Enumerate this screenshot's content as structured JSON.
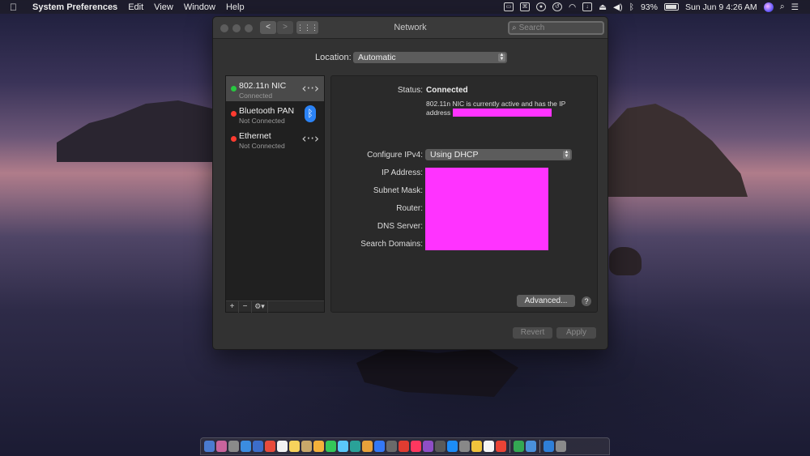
{
  "menubar": {
    "app_name": "System Preferences",
    "items": [
      "Edit",
      "View",
      "Window",
      "Help"
    ],
    "status": {
      "icons": [
        "screen-mirroring-icon",
        "command-icon",
        "lock-icon",
        "time-machine-icon",
        "wifi-icon",
        "input-icon",
        "eject-icon",
        "volume-icon",
        "bluetooth-icon"
      ],
      "battery_percent": "93%",
      "datetime": "Sun Jun 9  4:26 AM"
    }
  },
  "window": {
    "title": "Network",
    "search_placeholder": "Search",
    "location_label": "Location:",
    "location_value": "Automatic",
    "services": [
      {
        "name": "802.11n NIC",
        "status": "Connected",
        "dot_color": "#28c840",
        "icon": "ethernet-arrows-icon"
      },
      {
        "name": "Bluetooth PAN",
        "status": "Not Connected",
        "dot_color": "#ff3b30",
        "icon": "bluetooth-icon"
      },
      {
        "name": "Ethernet",
        "status": "Not Connected",
        "dot_color": "#ff3b30",
        "icon": "ethernet-arrows-icon"
      }
    ],
    "detail": {
      "status_label": "Status:",
      "status_value": "Connected",
      "status_description": "802.11n NIC  is currently active and has the IP address",
      "configure_label": "Configure IPv4:",
      "configure_value": "Using DHCP",
      "ip_label": "IP Address:",
      "subnet_label": "Subnet Mask:",
      "router_label": "Router:",
      "dns_label": "DNS Server:",
      "search_domains_label": "Search Domains:",
      "advanced_label": "Advanced...",
      "help_label": "?"
    },
    "revert_label": "Revert",
    "apply_label": "Apply",
    "tools": {
      "add": "+",
      "remove": "−",
      "gear": "⚙▾"
    }
  },
  "dock": {
    "icon_colors": [
      "#4a7bd0",
      "#c9649c",
      "#8a8a8a",
      "#3b8de0",
      "#3c6dc9",
      "#e84b3c",
      "#f2f2f2",
      "#f7d25c",
      "#c8a86a",
      "#f4b13a",
      "#34c759",
      "#5ac8fa",
      "#2aa198",
      "#e8a13a",
      "#3478f6",
      "#6a6a6a",
      "#e03c31",
      "#ff375f",
      "#8e4ec6",
      "#5a5a5a",
      "#1c8cf8",
      "#888888",
      "#f0c33c",
      "#f5f5f5",
      "#ea4335",
      "#34a853",
      "#4a90d9",
      "#2f7fd8",
      "#8a8a8a"
    ]
  }
}
